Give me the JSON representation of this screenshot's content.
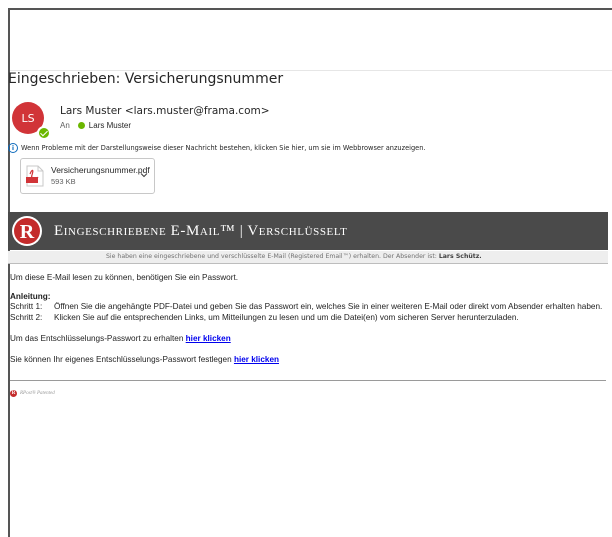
{
  "email": {
    "subject": "Eingeschrieben: Versicherungsnummer",
    "avatar_initials": "LS",
    "sender": "Lars Muster <lars.muster@frama.com>",
    "to_label": "An",
    "to_name": "Lars Muster",
    "info_text": "Wenn Probleme mit der Darstellungsweise dieser Nachricht bestehen, klicken Sie hier, um sie im Webbrowser anzuzeigen."
  },
  "attachment": {
    "name": "Versicherungsnummer.pdf",
    "size": "593 KB",
    "icon": "pdf-icon"
  },
  "banner": {
    "logo_letter": "R",
    "title": "Eingeschriebene E-Mail™ | Verschlüsselt",
    "subtitle_prefix": "Sie haben eine eingeschriebene und verschlüsselte E-Mail (Registered Email™) erhalten. Der Absender ist:",
    "subtitle_sender": "Lars Schütz."
  },
  "body": {
    "intro": "Um diese E-Mail lesen zu können, benötigen Sie ein Passwort.",
    "instructions_heading": "Anleitung:",
    "step1_label": "Schritt 1:",
    "step1_text": "Öffnen Sie die angehängte PDF-Datei und geben Sie das Passwort ein, welches Sie in einer weiteren E-Mail oder direkt vom Absender erhalten haben.",
    "step2_label": "Schritt 2:",
    "step2_text": "Klicken Sie auf die entsprechenden Links, um Mitteilungen zu lesen und um die Datei(en) vom sicheren Server herunterzuladen.",
    "password_text": "Um das Entschlüsselungs-Passwort zu erhalten",
    "password_link": "hier klicken",
    "own_password_text": "Sie können Ihr eigenes Entschlüsselungs-Passwort festlegen",
    "own_password_link": "hier klicken"
  },
  "footer": {
    "logo_letter": "R",
    "text": "RPost® Patented"
  },
  "colors": {
    "avatar": "#d13438",
    "presence": "#6bb700",
    "banner": "#4a4a4a",
    "link": "#0000ee",
    "info": "#0f6cbd"
  }
}
